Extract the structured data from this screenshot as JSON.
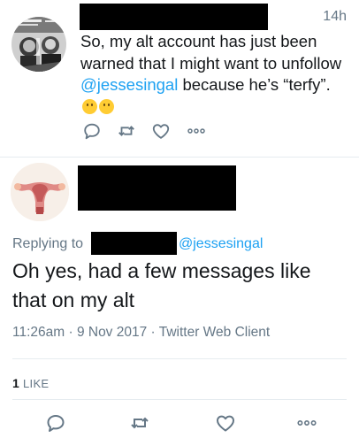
{
  "tweet1": {
    "time": "14h",
    "text_before": "So, my alt account has just been warned that I might want to unfollow ",
    "mention": "@jessesingal",
    "text_after": " because he’s “terfy”.",
    "emojis": [
      "thinking-face",
      "rolling-eyes-face"
    ],
    "actions": [
      "reply",
      "retweet",
      "like",
      "more"
    ]
  },
  "tweet2": {
    "replying_prefix": "Replying to",
    "replying_mention": "@jessesingal",
    "text": "Oh yes, had a few messages like that on my alt",
    "meta": "11:26am · 9 Nov 2017 · Twitter Web Client",
    "likes_count": "1",
    "likes_label": "LIKE",
    "actions": [
      "reply",
      "retweet",
      "like",
      "more"
    ]
  },
  "colors": {
    "accent": "#1da1f2",
    "secondary_text": "#657786",
    "primary_text": "#14171a",
    "divider": "#e6ecf0",
    "redaction": "#000000"
  }
}
